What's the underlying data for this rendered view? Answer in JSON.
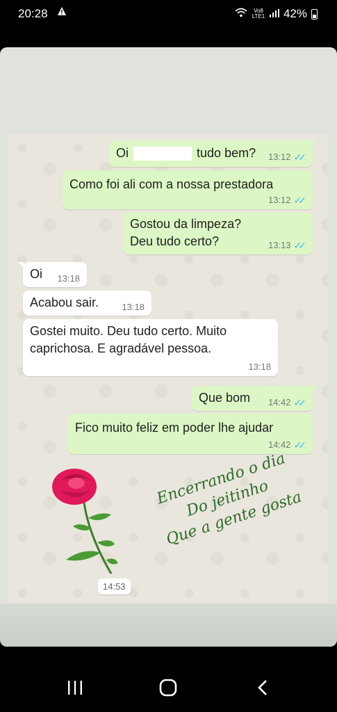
{
  "status_bar": {
    "time": "20:28",
    "network": "Vo8 LTE1",
    "battery": "42%",
    "battery_level": 0.42
  },
  "messages": [
    {
      "dir": "out",
      "text_before": "Oi",
      "text_after": "tudo bem?",
      "time": "13:12",
      "read": true,
      "redacted": true
    },
    {
      "dir": "out",
      "text": "Como foi ali com a nossa prestadora",
      "time": "13:12",
      "read": true
    },
    {
      "dir": "out",
      "lines": [
        "Gostou da limpeza?",
        "Deu tudo certo?"
      ],
      "time": "13:13",
      "read": true
    },
    {
      "dir": "in",
      "text": "Oi",
      "time": "13:18"
    },
    {
      "dir": "in",
      "text": "Acabou sair.",
      "time": "13:18"
    },
    {
      "dir": "in",
      "lines": [
        "Gostei muito. Deu tudo certo.  Muito",
        "caprichosa.  E agradável pessoa."
      ],
      "time": "13:18"
    },
    {
      "dir": "out",
      "text": "Que bom",
      "time": "14:42",
      "read": true
    },
    {
      "dir": "out",
      "text": "Fico muito feliz em poder lhe ajudar",
      "time": "14:42",
      "read": true
    }
  ],
  "sticker": {
    "lines": [
      "Encerrando o dia",
      "Do jeitinho",
      "Que a gente gosta"
    ],
    "time": "14:53",
    "icon": "rose-icon"
  },
  "colors": {
    "outgoing": "#dcf7c5",
    "incoming": "#ffffff",
    "ticks": "#4fb6ec",
    "sticker_text": "#2e6b2a",
    "rose": "#e0195b"
  },
  "nav": {
    "recents": "recents-icon",
    "home": "home-icon",
    "back": "back-icon"
  }
}
